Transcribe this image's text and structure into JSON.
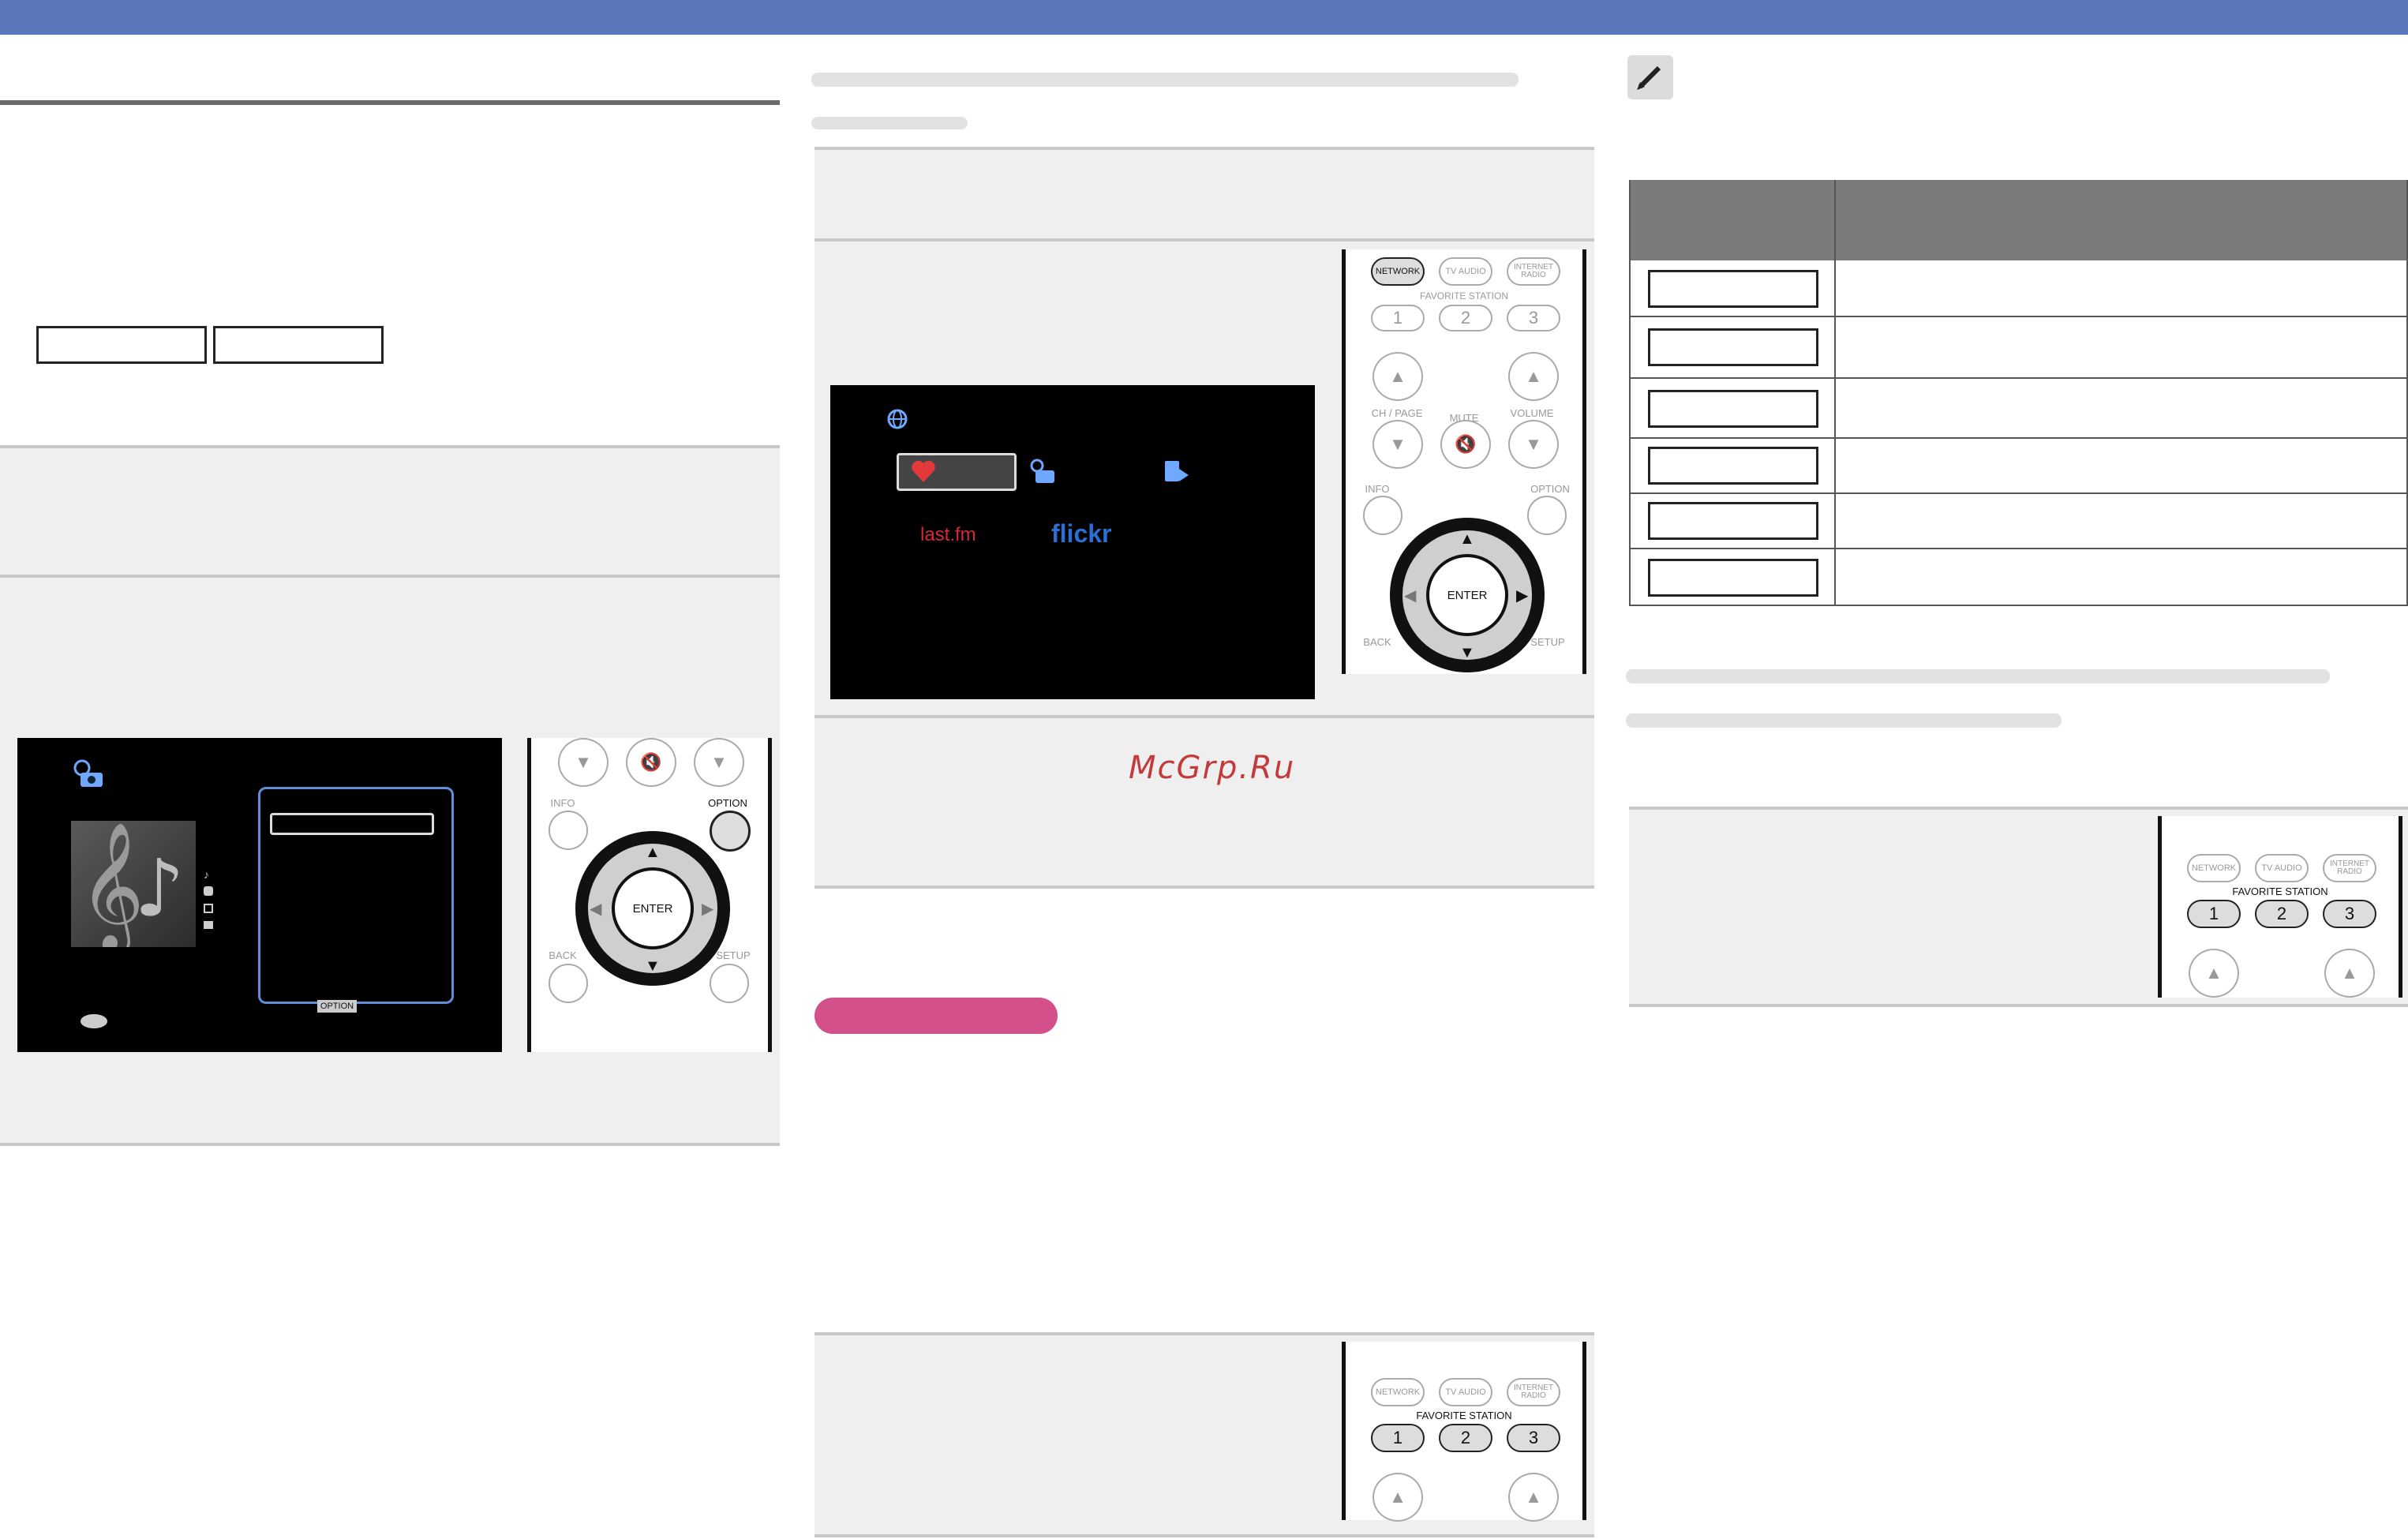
{
  "watermark": "McGrp.Ru",
  "screen_top": {
    "services": [
      "last.fm",
      "flickr"
    ]
  },
  "remote_labels": {
    "network": "NETWORK",
    "tv_audio": "TV AUDIO",
    "internet_radio": "INTERNET RADIO",
    "favorite_station": "FAVORITE STATION",
    "fav1": "1",
    "fav2": "2",
    "fav3": "3",
    "ch_page": "CH / PAGE",
    "mute": "MUTE",
    "volume": "VOLUME",
    "info": "INFO",
    "option": "OPTION",
    "enter": "ENTER",
    "back": "BACK",
    "setup": "SETUP"
  },
  "screen_bottom": {
    "option_label": "OPTION"
  }
}
